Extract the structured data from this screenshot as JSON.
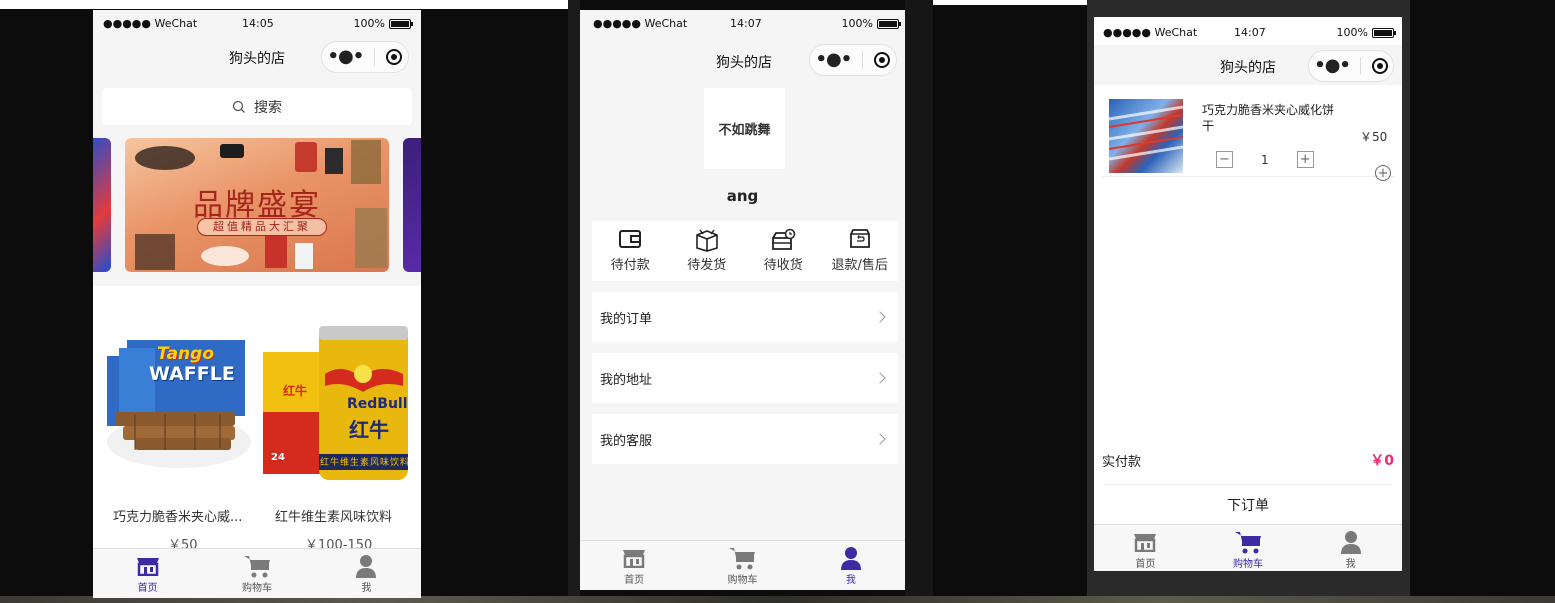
{
  "status": {
    "signal": "●●●●● WeChat",
    "battery": "100%",
    "time_1": "14:05",
    "time_2": "14:07",
    "time_3": "14:07"
  },
  "nav": {
    "title": "狗头的店"
  },
  "home": {
    "search_placeholder": "搜索",
    "banner": {
      "title": "品牌盛宴",
      "subtitle": "超值精品大汇聚"
    },
    "products": [
      {
        "name": "巧克力脆香米夹心威...",
        "price": "￥50",
        "brand": "Tango",
        "sub": "WAFFLE"
      },
      {
        "name": "红牛维生素风味饮料",
        "price": "￥100-150",
        "brand": "RedBull",
        "sub": "红牛",
        "can_label": "红牛维生素风味饮料",
        "box_label": "红牛",
        "box_count": "24"
      }
    ]
  },
  "profile": {
    "avatar_text": "不如跳舞",
    "username": "ang",
    "orders": [
      {
        "label": "待付款",
        "icon": "wallet-icon"
      },
      {
        "label": "待发货",
        "icon": "box-icon"
      },
      {
        "label": "待收货",
        "icon": "delivery-icon"
      },
      {
        "label": "退款/售后",
        "icon": "refund-icon"
      }
    ],
    "menu": [
      {
        "label": "我的订单"
      },
      {
        "label": "我的地址"
      },
      {
        "label": "我的客服"
      }
    ]
  },
  "cart": {
    "item": {
      "name": "巧克力脆香米夹心威化饼干",
      "price": "￥50",
      "qty": "1",
      "minus": "−",
      "plus": "+"
    },
    "total_label": "实付款",
    "total_value": "￥0",
    "submit_label": "下订单"
  },
  "tabs": [
    {
      "label": "首页",
      "icon": "store-icon"
    },
    {
      "label": "购物车",
      "icon": "cart-icon"
    },
    {
      "label": "我",
      "icon": "user-icon"
    }
  ],
  "colors": {
    "accent": "#3f2aa4",
    "price_red": "#e6306a",
    "tab_inactive": "#666666"
  }
}
